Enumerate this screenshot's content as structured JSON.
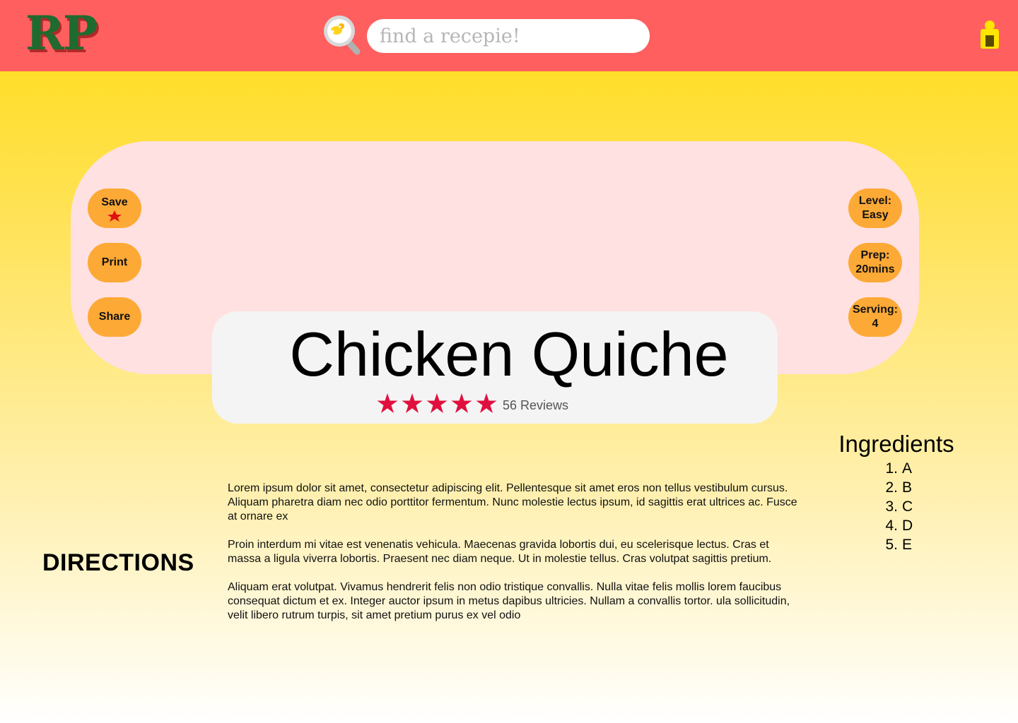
{
  "header": {
    "logo": "RP",
    "search": {
      "placeholder": "find a recepie!",
      "value": "",
      "icon": "search-icon"
    },
    "user_icon": "user-icon",
    "background": "#ff5f5f"
  },
  "actions": {
    "save_label": "Save",
    "print_label": "Print",
    "share_label": "Share"
  },
  "info": {
    "level": {
      "label": "Level:",
      "value": "Easy"
    },
    "prep": {
      "label": "Prep:",
      "value": "20mins"
    },
    "serving": {
      "label": "Serving:",
      "value": "4"
    }
  },
  "recipe": {
    "title": "Chicken Quiche",
    "rating": 5,
    "reviews": "56 Reviews"
  },
  "directions": {
    "label": "DIRECTIONS",
    "paragraphs": [
      "Lorem ipsum dolor sit amet, consectetur adipiscing elit. Pellentesque sit amet eros non tellus vestibulum cursus. Aliquam pharetra diam nec odio porttitor fermentum. Nunc molestie lectus ipsum, id sagittis erat ultrices ac. Fusce at ornare ex",
      "Proin interdum mi vitae est venenatis vehicula. Maecenas gravida lobortis dui, eu scelerisque lectus. Cras et massa a ligula viverra lobortis. Praesent nec diam neque. Ut in molestie tellus. Cras volutpat sagittis pretium.",
      "Aliquam erat volutpat. Vivamus hendrerit felis non odio tristique convallis. Nulla vitae felis mollis lorem faucibus consequat dictum et ex. Integer auctor ipsum in metus dapibus ultricies. Nullam a convallis tortor. ula sollicitudin, velit libero rutrum turpis, sit amet pretium purus ex vel odio"
    ]
  },
  "ingredients": {
    "title": "Ingredients",
    "items": [
      {
        "num": "1.",
        "name": "A"
      },
      {
        "num": "2.",
        "name": "B"
      },
      {
        "num": "3.",
        "name": "C"
      },
      {
        "num": "4.",
        "name": "D"
      },
      {
        "num": "5.",
        "name": "E"
      }
    ]
  },
  "colors": {
    "accent": "#fda936",
    "hero_bg": "#ffe1e1",
    "star": "#e0103e",
    "logo_green": "#1f6b2f"
  }
}
